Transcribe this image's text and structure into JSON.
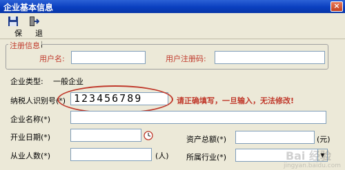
{
  "window": {
    "title": "企业基本信息",
    "close_icon": "close-icon"
  },
  "toolbar": {
    "save": {
      "label": "保存",
      "icon": "save-icon"
    },
    "exit": {
      "label": "退出",
      "icon": "exit-icon"
    }
  },
  "registration": {
    "group_title": "注册信息",
    "username_label": "用户名:",
    "username_value": "",
    "regcode_label": "用户注册码:",
    "regcode_value": ""
  },
  "form": {
    "company_type_label": "企业类型:",
    "company_type_value": "一般企业",
    "taxpayer_id_label": "纳税人识别号(*)",
    "taxpayer_id_value": "123456789",
    "warning": "请正确填写，一旦输入，无法修改!",
    "company_name_label": "企业名称(*)",
    "company_name_value": "",
    "start_date_label": "开业日期(*)",
    "start_date_value": "",
    "assets_label": "资产总额(*)",
    "assets_value": "",
    "assets_unit": "(元)",
    "employees_label": "从业人数(*)",
    "employees_value": "",
    "employees_unit": "(人)",
    "industry_label": "所属行业(*)",
    "industry_value": ""
  },
  "watermark": {
    "brand": "Bai 经验",
    "url": "jingyan.baidu.com"
  },
  "colors": {
    "accent_red": "#c0392b",
    "title_blue": "#0a3fbf"
  }
}
